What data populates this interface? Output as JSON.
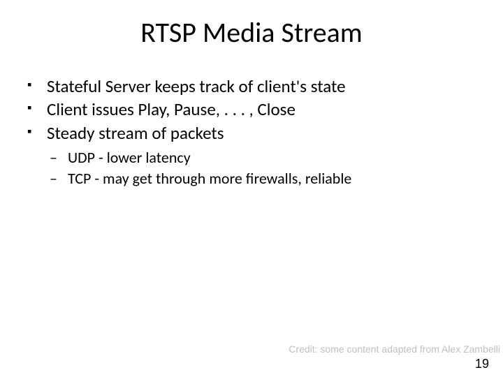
{
  "title": "RTSP Media Stream",
  "bullets": {
    "b1": "Stateful Server keeps track of client's state",
    "b2": "Client issues Play, Pause, . . . , Close",
    "b3": "Steady stream of packets"
  },
  "sub": {
    "s1": "UDP - lower latency",
    "s2": "TCP - may get through more firewalls, reliable"
  },
  "credit": "Credit: some content adapted from Alex Zambelli",
  "page": "19"
}
